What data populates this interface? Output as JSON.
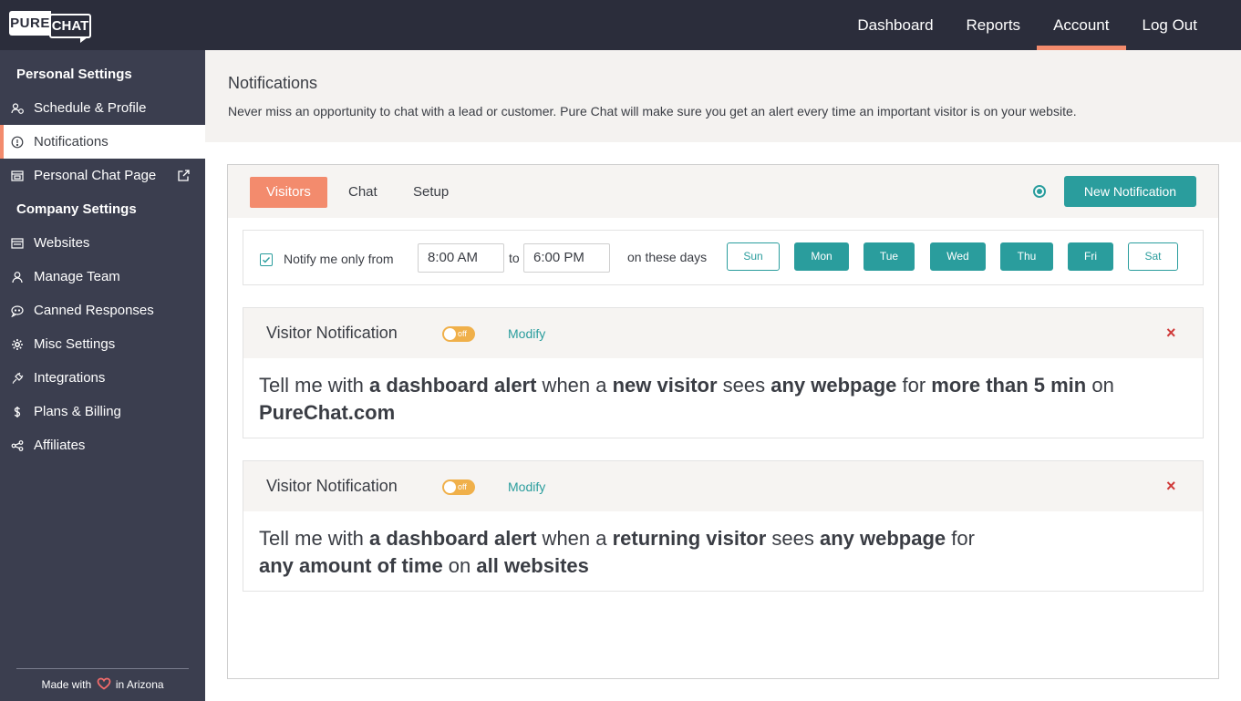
{
  "header": {
    "logo_pure": "PURE",
    "logo_chat": "CHAT",
    "nav": [
      {
        "label": "Dashboard"
      },
      {
        "label": "Reports"
      },
      {
        "label": "Account"
      },
      {
        "label": "Log Out"
      }
    ]
  },
  "sidebar": {
    "personal_title": "Personal Settings",
    "personal_items": [
      {
        "label": "Schedule & Profile",
        "icon": "user-clock-icon"
      },
      {
        "label": "Notifications",
        "icon": "info-circle-icon"
      },
      {
        "label": "Personal Chat Page",
        "icon": "chat-page-icon"
      }
    ],
    "company_title": "Company Settings",
    "company_items": [
      {
        "label": "Websites",
        "icon": "browser-icon"
      },
      {
        "label": "Manage Team",
        "icon": "user-icon"
      },
      {
        "label": "Canned Responses",
        "icon": "chat-bubble-icon"
      },
      {
        "label": "Misc Settings",
        "icon": "gear-icon"
      },
      {
        "label": "Integrations",
        "icon": "plug-icon"
      },
      {
        "label": "Plans & Billing",
        "icon": "dollar-icon"
      },
      {
        "label": "Affiliates",
        "icon": "share-icon"
      }
    ],
    "footer_before": "Made with",
    "footer_after": "in Arizona"
  },
  "page": {
    "title": "Notifications",
    "description": "Never miss an opportunity to chat with a lead or customer. Pure Chat will make sure you get an alert every time an important visitor is on your website."
  },
  "tabs": [
    {
      "label": "Visitors"
    },
    {
      "label": "Chat"
    },
    {
      "label": "Setup"
    }
  ],
  "new_notification_label": "New Notification",
  "schedule": {
    "label": "Notify me only from",
    "from": "8:00 AM",
    "to_label": "to",
    "to": "6:00 PM",
    "days_label": "on these days",
    "days": [
      {
        "label": "Sun",
        "on": false
      },
      {
        "label": "Mon",
        "on": true
      },
      {
        "label": "Tue",
        "on": true
      },
      {
        "label": "Wed",
        "on": true
      },
      {
        "label": "Thu",
        "on": true
      },
      {
        "label": "Fri",
        "on": true
      },
      {
        "label": "Sat",
        "on": false
      }
    ]
  },
  "notifications": [
    {
      "title": "Visitor Notification",
      "toggle": "off",
      "modify": "Modify",
      "close": "×",
      "s": {
        "t1": "Tell me with ",
        "b1": "a dashboard alert",
        "t2": " when a ",
        "b2": "new visitor",
        "t3": " sees ",
        "b3": "any webpage",
        "t4": " for ",
        "b4": "more than 5 min",
        "t5": " on ",
        "b5": "PureChat.com"
      }
    },
    {
      "title": "Visitor Notification",
      "toggle": "off",
      "modify": "Modify",
      "close": "×",
      "s": {
        "t1": "Tell me with ",
        "b1": "a dashboard alert",
        "t2": " when a ",
        "b2": "returning visitor",
        "t3": " sees ",
        "b3": "any webpage",
        "t4": " for ",
        "b4": "any amount of time",
        "t5": " on ",
        "b5": "all websites"
      }
    }
  ],
  "colors": {
    "accent": "#f38b6d",
    "teal": "#2a9d9d",
    "topbar": "#2b2d3b",
    "sidebar": "#3b3e4f",
    "toggle_off": "#f0b04a",
    "danger": "#d03a3a"
  }
}
